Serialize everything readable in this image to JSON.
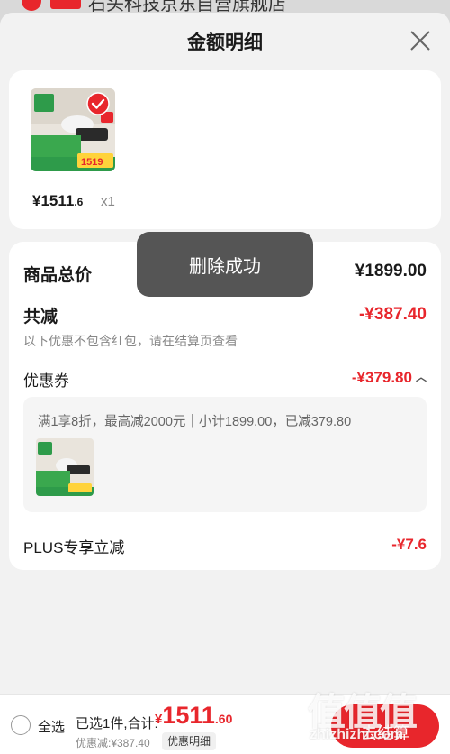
{
  "store": {
    "name": "石头科技京东自营旗舰店"
  },
  "sheet": {
    "title": "金额明细"
  },
  "product": {
    "price_integer": "¥1511",
    "price_decimal": ".6",
    "quantity": "x1",
    "image_badge_price": "1519",
    "selected": true
  },
  "detail": {
    "total_label": "商品总价",
    "total_value": "¥1899.00",
    "reduce_label": "共减",
    "reduce_value": "-¥387.40",
    "reduce_note": "以下优惠不包含红包，请在结算页查看",
    "coupon_label": "优惠券",
    "coupon_value": "-¥379.80",
    "coupon_desc": "满1享8折，最高减2000元｜小计1899.00，已减379.80",
    "plus_label": "PLUS专享立减",
    "plus_value": "-¥7.6"
  },
  "toast": {
    "message": "删除成功"
  },
  "bottom_bar": {
    "select_all_label": "全选",
    "selected_text": "已选1件,合计:",
    "sum_currency": "¥",
    "sum_integer": "1511",
    "sum_decimal": ".60",
    "discount_text": "优惠减:¥387.40",
    "detail_chip": "优惠明细",
    "checkout_label": "去结算"
  },
  "watermark": {
    "glyphs": "值值值",
    "url": "zhizhizhi.com"
  },
  "colors": {
    "accent_red": "#e8262c",
    "sheet_bg": "#f2f2f2",
    "toast_bg": "#555555"
  }
}
